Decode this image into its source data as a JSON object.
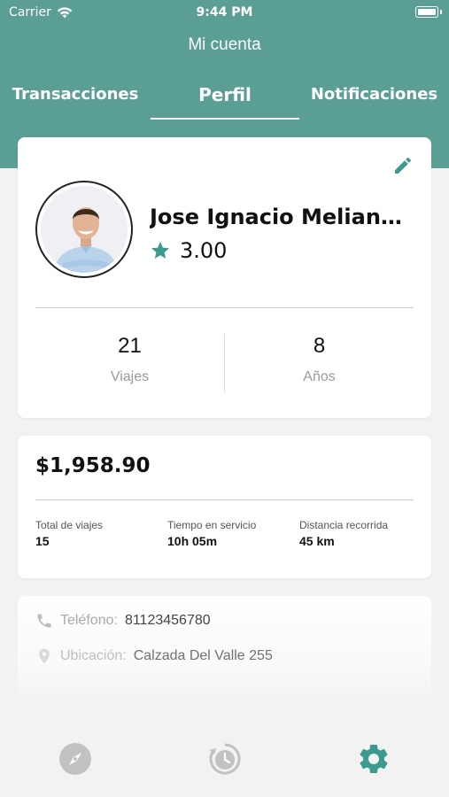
{
  "status_bar": {
    "carrier": "Carrier",
    "time": "9:44 PM"
  },
  "nav": {
    "title": "Mi cuenta"
  },
  "tabs": [
    {
      "label": "Transacciones",
      "active": false
    },
    {
      "label": "Perfil",
      "active": true
    },
    {
      "label": "Notificaciones",
      "active": false
    }
  ],
  "profile": {
    "name": "Jose Ignacio Melian…",
    "rating": "3.00",
    "edit_icon": "pencil-icon",
    "stats": [
      {
        "value": "21",
        "label": "Viajes"
      },
      {
        "value": "8",
        "label": "Años"
      }
    ]
  },
  "earnings": {
    "amount": "$1,958.90",
    "metrics": [
      {
        "label": "Total de viajes",
        "value": "15"
      },
      {
        "label": "Tiempo en servicio",
        "value": "10h 05m"
      },
      {
        "label": "Distancia recorrida",
        "value": "45 km"
      }
    ]
  },
  "contact": {
    "phone_label": "Teléfono:",
    "phone_value": "81123456780",
    "location_label": "Ubicación:",
    "location_value": "Calzada Del Valle 255"
  },
  "bottom_tabs": [
    {
      "icon": "compass-icon",
      "active": false
    },
    {
      "icon": "history-clock-icon",
      "active": false
    },
    {
      "icon": "settings-gear-icon",
      "active": true
    }
  ],
  "colors": {
    "primary": "#5b9e94",
    "accent_icon": "#3c9a8f",
    "inactive_icon": "#c2c2c2"
  }
}
